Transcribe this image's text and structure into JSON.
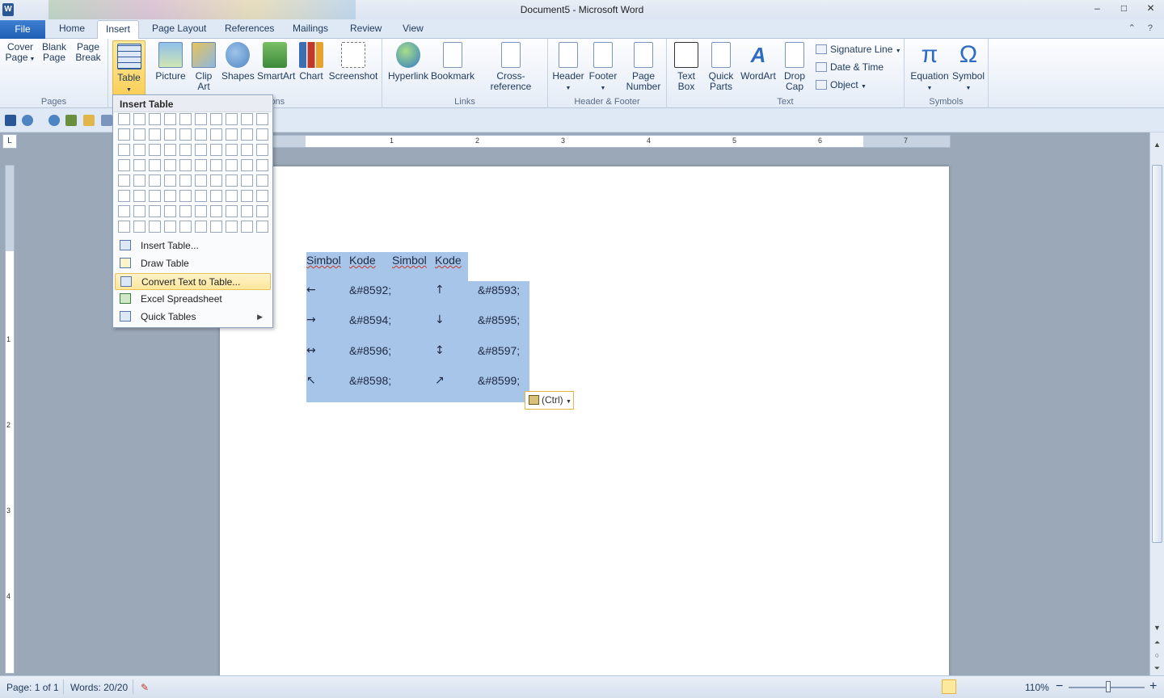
{
  "window": {
    "title": "Document5  -  Microsoft Word",
    "app_icon": "W",
    "controls": [
      "–",
      "□",
      "✕"
    ]
  },
  "tabs": {
    "file": "File",
    "items": [
      "Home",
      "Insert",
      "Page Layout",
      "References",
      "Mailings",
      "Review",
      "View"
    ],
    "active": "Insert"
  },
  "ribbon": {
    "pages": {
      "label": "Pages",
      "cover": "Cover\nPage",
      "blank": "Blank\nPage",
      "break": "Page\nBreak"
    },
    "tables": {
      "table": "Table"
    },
    "illustrations": {
      "label_partial": "ions",
      "picture": "Picture",
      "clipart": "Clip\nArt",
      "shapes": "Shapes",
      "smartart": "SmartArt",
      "chart": "Chart",
      "screenshot": "Screenshot"
    },
    "links": {
      "label": "Links",
      "hyperlink": "Hyperlink",
      "bookmark": "Bookmark",
      "crossref": "Cross-reference"
    },
    "headerfooter": {
      "label": "Header & Footer",
      "header": "Header",
      "footer": "Footer",
      "pagenumber": "Page\nNumber"
    },
    "text": {
      "label": "Text",
      "textbox": "Text\nBox",
      "quickparts": "Quick\nParts",
      "wordart": "WordArt",
      "dropcap": "Drop\nCap",
      "signature": "Signature Line",
      "datetime": "Date & Time",
      "object": "Object"
    },
    "symbols": {
      "label": "Symbols",
      "equation": "Equation",
      "symbol": "Symbol",
      "pi": "π",
      "omega": "Ω"
    }
  },
  "insert_table_menu": {
    "title": "Insert Table",
    "grid_cols": 10,
    "grid_rows": 8,
    "items": [
      {
        "label": "Insert Table...",
        "icon": "table-icon"
      },
      {
        "label": "Draw Table",
        "icon": "pencil-icon"
      },
      {
        "label": "Convert Text to Table...",
        "icon": "convert-icon",
        "highlighted": true
      },
      {
        "label": "Excel Spreadsheet",
        "icon": "excel-icon"
      },
      {
        "label": "Quick Tables",
        "icon": "quick-tables-icon",
        "submenu": true
      }
    ]
  },
  "ruler": {
    "numbers": [
      "1",
      "2",
      "3",
      "4",
      "5",
      "6",
      "7"
    ],
    "vnumbers": [
      "1",
      "2",
      "3",
      "4"
    ],
    "corner": "L"
  },
  "document": {
    "header": [
      "Simbol",
      "Kode",
      "Simbol",
      "Kode"
    ],
    "rows": [
      [
        "←",
        "&#8592;",
        "↑",
        "&#8593;"
      ],
      [
        "→",
        "&#8594;",
        "↓",
        "&#8595;"
      ],
      [
        "↔",
        "&#8596;",
        "↕",
        "&#8597;"
      ],
      [
        "↖",
        "&#8598;",
        "↗",
        "&#8599;"
      ]
    ],
    "paste_options": "(Ctrl)"
  },
  "status": {
    "page": "Page: 1 of 1",
    "words": "Words: 20/20",
    "zoom": "110%",
    "zoom_minus": "−",
    "zoom_plus": "+"
  },
  "colors": {
    "selection": "#a7c5e8",
    "accent": "#2b5797",
    "highlight": "#fde79b"
  }
}
